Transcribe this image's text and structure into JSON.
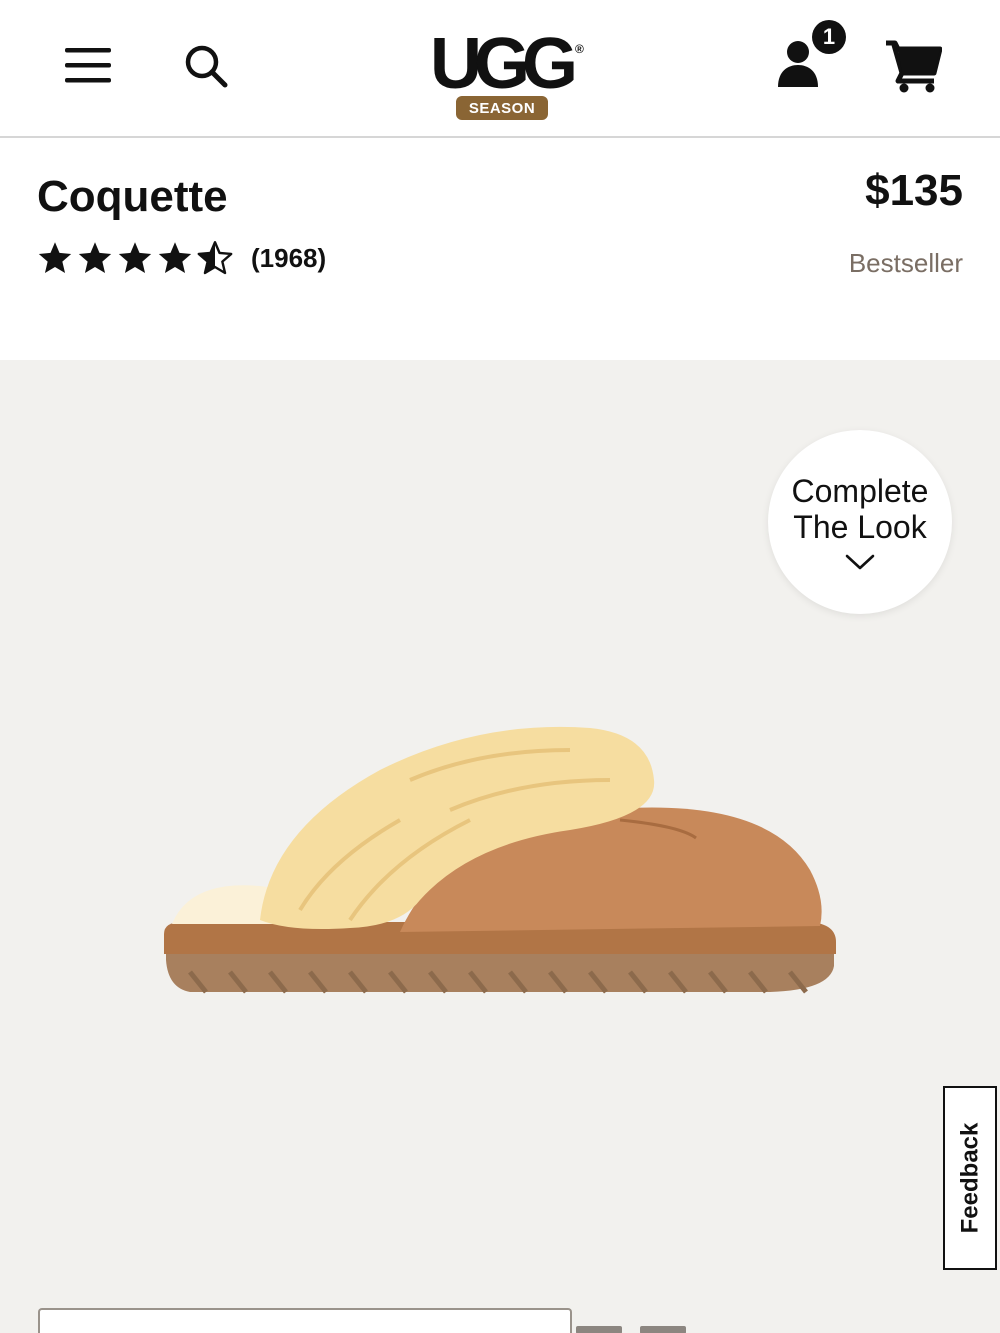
{
  "header": {
    "menu_icon": "hamburger-menu-icon",
    "search_icon": "search-icon",
    "logo": {
      "wordmark": "UGG",
      "registered": "®",
      "sublabel": "SEASON"
    },
    "account_icon": "user-icon",
    "account_badge": "1",
    "cart_icon": "cart-icon"
  },
  "product": {
    "title": "Coquette",
    "price": "$135",
    "rating_value": 4.5,
    "review_count": "(1968)",
    "tag": "Bestseller"
  },
  "gallery": {
    "complete_look_line1": "Complete",
    "complete_look_line2": "The Look",
    "complete_look_icon": "chevron-down-icon",
    "feedback_label": "Feedback"
  },
  "colors": {
    "brand_brown": "#8a6534",
    "gallery_bg": "#f2f1ee",
    "muted_text": "#7a6e64"
  }
}
